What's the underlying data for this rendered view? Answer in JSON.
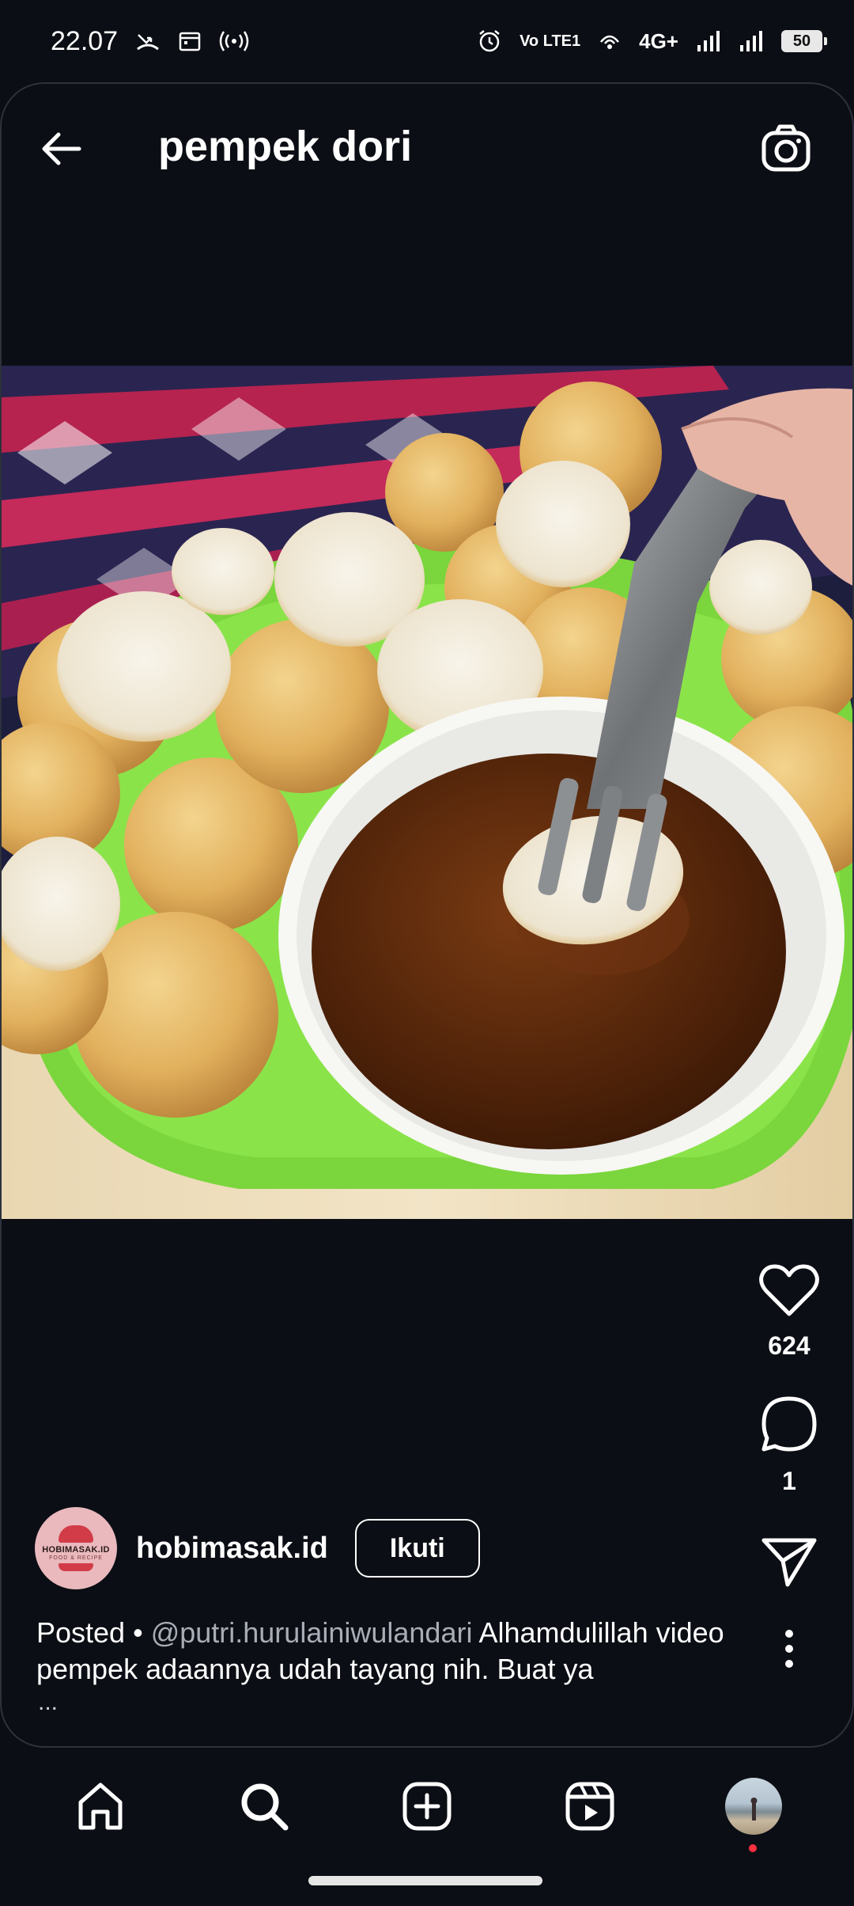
{
  "status_bar": {
    "time": "22.07",
    "volte": "Vo LTE1",
    "network": "4G+",
    "battery": "50"
  },
  "header": {
    "title": "pempek dori"
  },
  "post": {
    "likes": "624",
    "comments": "1",
    "author": {
      "username": "hobimasak.id",
      "avatar_text": "HOBIMASAK.ID",
      "avatar_sub": "FOOD & RECIPE"
    },
    "follow_label": "Ikuti",
    "caption": {
      "prefix": "Posted • ",
      "mention": "@putri.hurulainiwulandari",
      "text": " Alhamdulillah video pempek adaannya udah tayang nih. Buat ya",
      "more": "..."
    }
  },
  "icons": {
    "back": "arrow-left-icon",
    "camera": "camera-icon",
    "like": "heart-icon",
    "comment": "comment-bubble-icon",
    "share": "paper-plane-icon",
    "more": "more-vertical-icon",
    "nav": [
      "home-icon",
      "search-icon",
      "add-post-icon",
      "reels-icon",
      "profile-avatar"
    ]
  },
  "colors": {
    "background": "#0b0e14",
    "text": "#ffffff",
    "mention": "#a8adb6",
    "notification_dot": "#ff3040"
  }
}
